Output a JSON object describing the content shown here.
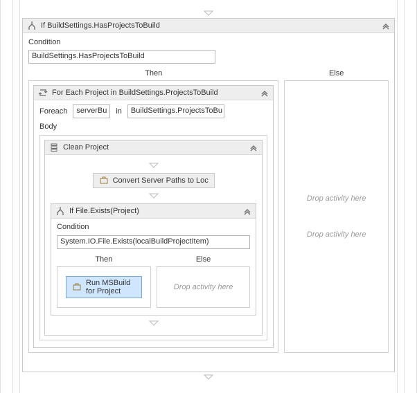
{
  "root": {
    "if_title": "If BuildSettings.HasProjectsToBuild",
    "condition_label": "Condition",
    "condition_value": "BuildSettings.HasProjectsToBuild",
    "then_label": "Then",
    "else_label": "Else",
    "else_drop1": "Drop activity here",
    "else_drop2": "Drop activity here"
  },
  "foreach": {
    "title": "For Each Project in BuildSettings.ProjectsToBuild",
    "foreach_label": "Foreach",
    "var_value": "serverBu",
    "in_label": "in",
    "collection_value": "BuildSettings.ProjectsToBu",
    "body_label": "Body"
  },
  "clean": {
    "title": "Clean Project",
    "convert_label": "Convert Server Paths to Loc"
  },
  "inner_if": {
    "title": "If File.Exists(Project)",
    "condition_label": "Condition",
    "condition_value": "System.IO.File.Exists(localBuildProjectItem)",
    "then_label": "Then",
    "else_label": "Else",
    "run_label": "Run MSBuild for Project",
    "else_drop": "Drop activity here"
  }
}
